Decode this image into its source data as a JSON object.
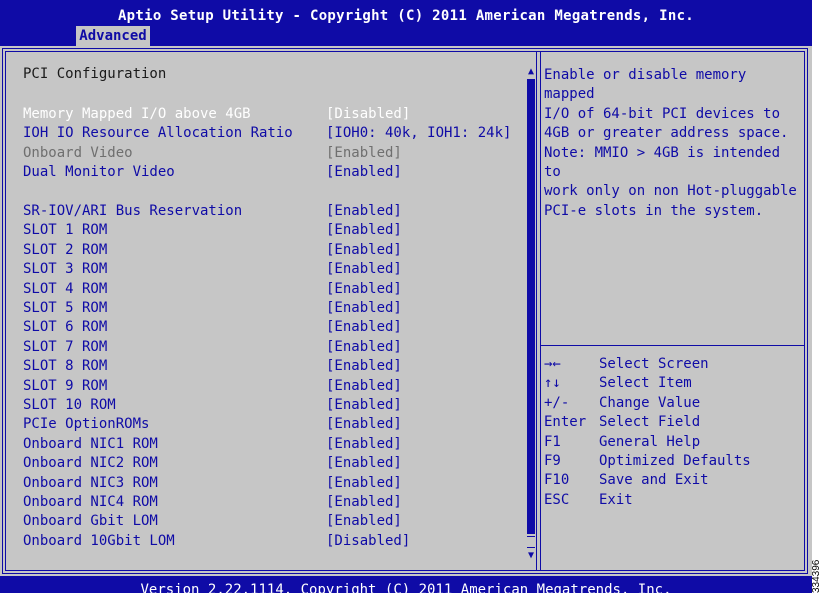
{
  "header": {
    "title": "Aptio Setup Utility - Copyright (C) 2011 American Megatrends, Inc.",
    "tab_label": "Advanced"
  },
  "colors": {
    "accent": "#0f0ba6",
    "panel": "#c6c6c6",
    "selected": "#ffffff",
    "disabled": "#6f6f6f"
  },
  "main": {
    "section_title": "PCI Configuration",
    "settings": [
      {
        "label": "Memory Mapped I/O above 4GB",
        "value": "[Disabled]",
        "state": "selected"
      },
      {
        "label": "IOH IO Resource Allocation Ratio",
        "value": "[IOH0: 40k, IOH1: 24k]",
        "state": "normal"
      },
      {
        "label": "Onboard Video",
        "value": "[Enabled]",
        "state": "disabled"
      },
      {
        "label": "Dual Monitor Video",
        "value": "[Enabled]",
        "state": "normal"
      },
      {
        "label": "SR-IOV/ARI Bus Reservation",
        "value": "[Enabled]",
        "state": "normal"
      },
      {
        "label": "SLOT 1 ROM",
        "value": "[Enabled]",
        "state": "normal"
      },
      {
        "label": "SLOT 2 ROM",
        "value": "[Enabled]",
        "state": "normal"
      },
      {
        "label": "SLOT 3 ROM",
        "value": "[Enabled]",
        "state": "normal"
      },
      {
        "label": "SLOT 4 ROM",
        "value": "[Enabled]",
        "state": "normal"
      },
      {
        "label": "SLOT 5 ROM",
        "value": "[Enabled]",
        "state": "normal"
      },
      {
        "label": "SLOT 6 ROM",
        "value": "[Enabled]",
        "state": "normal"
      },
      {
        "label": "SLOT 7 ROM",
        "value": "[Enabled]",
        "state": "normal"
      },
      {
        "label": "SLOT 8 ROM",
        "value": "[Enabled]",
        "state": "normal"
      },
      {
        "label": "SLOT 9 ROM",
        "value": "[Enabled]",
        "state": "normal"
      },
      {
        "label": "SLOT 10 ROM",
        "value": "[Enabled]",
        "state": "normal"
      },
      {
        "label": "PCIe OptionROMs",
        "value": "[Enabled]",
        "state": "normal"
      },
      {
        "label": "Onboard NIC1 ROM",
        "value": "[Enabled]",
        "state": "normal"
      },
      {
        "label": "Onboard NIC2 ROM",
        "value": "[Enabled]",
        "state": "normal"
      },
      {
        "label": "Onboard NIC3 ROM",
        "value": "[Enabled]",
        "state": "normal"
      },
      {
        "label": "Onboard NIC4 ROM",
        "value": "[Enabled]",
        "state": "normal"
      },
      {
        "label": "Onboard Gbit LOM",
        "value": "[Enabled]",
        "state": "normal"
      },
      {
        "label": "Onboard 10Gbit LOM",
        "value": "[Disabled]",
        "state": "normal"
      }
    ]
  },
  "help": {
    "lines": [
      "Enable or disable memory mapped",
      "I/O of 64-bit PCI devices to",
      "4GB or greater address space.",
      "Note: MMIO > 4GB is intended to",
      "work only on non Hot-pluggable",
      "PCI-e slots in the system."
    ]
  },
  "keys": [
    {
      "key": "→←",
      "desc": "Select Screen"
    },
    {
      "key": "↑↓",
      "desc": "Select Item"
    },
    {
      "key": "+/-",
      "desc": "Change Value"
    },
    {
      "key": "Enter",
      "desc": "Select Field"
    },
    {
      "key": "F1",
      "desc": "General Help"
    },
    {
      "key": "F9",
      "desc": "Optimized Defaults"
    },
    {
      "key": "F10",
      "desc": "Save and Exit"
    },
    {
      "key": "ESC",
      "desc": "Exit"
    }
  ],
  "scrollbar": {
    "up_glyph": "▲",
    "down_glyph": "▼"
  },
  "footer": {
    "text": "Version 2.22.1114. Copyright (C) 2011 American Megatrends, Inc."
  },
  "side_code": "334396"
}
